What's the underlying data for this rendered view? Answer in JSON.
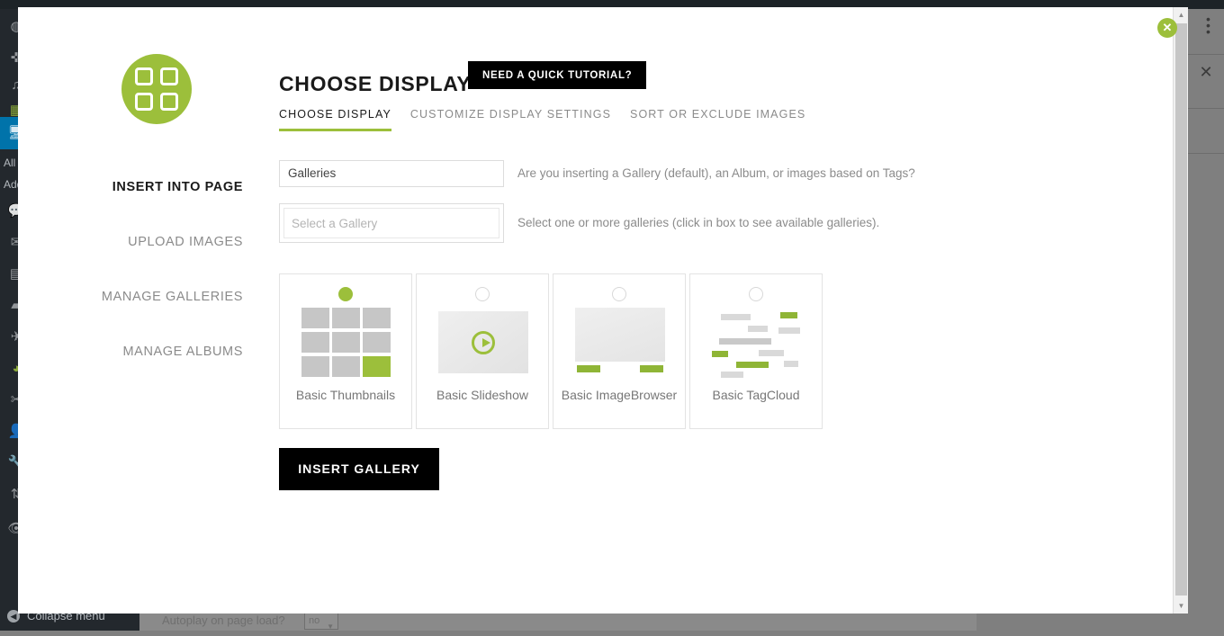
{
  "background": {
    "sidebar_icons": [
      "dashboard-icon",
      "pin-icon",
      "media-icon",
      "gallery-icon",
      "appearance-icon",
      "comments-icon",
      "mail-icon",
      "forms-icon",
      "pages-icon",
      "plugins-icon",
      "seo-icon",
      "tools-icon",
      "users-icon",
      "wrench-icon",
      "settings-icon",
      "eye-icon"
    ],
    "sub_items": [
      "All P",
      "Add"
    ],
    "collapse_menu_label": "Collapse menu",
    "collapse_arrow_glyph": "◀",
    "autoplay_label": "Autoplay on page load?",
    "autoplay_value": "no",
    "dots_icon": "vertical-dots-icon",
    "close_glyph": "✕"
  },
  "modal": {
    "close_glyph": "✕",
    "logo_icon": "four-squares-logo-icon",
    "title": "CHOOSE DISPLAY",
    "tutorial_button": "NEED A QUICK TUTORIAL?",
    "tabs": [
      {
        "label": "CHOOSE DISPLAY",
        "active": true
      },
      {
        "label": "CUSTOMIZE DISPLAY SETTINGS",
        "active": false
      },
      {
        "label": "SORT OR EXCLUDE IMAGES",
        "active": false
      }
    ],
    "sidebar": {
      "items": [
        {
          "label": "INSERT INTO PAGE",
          "active": true
        },
        {
          "label": "UPLOAD IMAGES",
          "active": false
        },
        {
          "label": "MANAGE GALLERIES",
          "active": false
        },
        {
          "label": "MANAGE ALBUMS",
          "active": false
        }
      ]
    },
    "fields": {
      "source_type": {
        "value": "Galleries",
        "help": "Are you inserting a Gallery (default), an Album, or images based on Tags?"
      },
      "gallery_select": {
        "placeholder": "Select a Gallery",
        "help": "Select one or more galleries (click in box to see available galleries)."
      }
    },
    "display_options": [
      {
        "label": "Basic Thumbnails",
        "selected": true,
        "thumb": "grid-thumbnail-art"
      },
      {
        "label": "Basic Slideshow",
        "selected": false,
        "thumb": "slideshow-play-art"
      },
      {
        "label": "Basic ImageBrowser",
        "selected": false,
        "thumb": "imagebrowser-art"
      },
      {
        "label": "Basic TagCloud",
        "selected": false,
        "thumb": "tagcloud-art"
      }
    ],
    "insert_button": "INSERT GALLERY",
    "scrollbar": {
      "up_glyph": "▲",
      "down_glyph": "▼"
    }
  },
  "colors": {
    "accent_green": "#9cbf3b",
    "black": "#000000",
    "muted_text": "#8b8b8b"
  }
}
